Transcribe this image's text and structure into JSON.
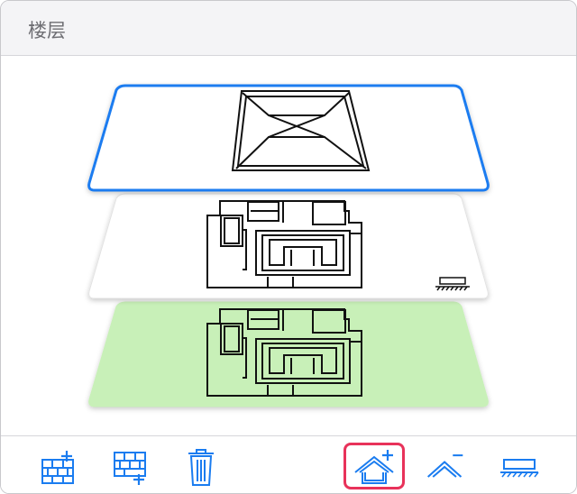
{
  "panel": {
    "title": "楼层"
  },
  "floors": [
    {
      "name": "roof",
      "selected": true,
      "fill": "#ffffff",
      "border": "#1a7cf0"
    },
    {
      "name": "upper-floor",
      "selected": false,
      "fill": "#ffffff",
      "border": "#dcdcdc"
    },
    {
      "name": "ground-floor",
      "selected": false,
      "fill": "#c8f0b8",
      "border": "#c8f0b8"
    }
  ],
  "toolbar": {
    "items": [
      {
        "icon": "add-wall-above-icon",
        "active": false
      },
      {
        "icon": "add-wall-below-icon",
        "active": false
      },
      {
        "icon": "trash-icon",
        "active": false
      },
      {
        "icon": "add-roof-icon",
        "active": true
      },
      {
        "icon": "remove-roof-icon",
        "active": false
      },
      {
        "icon": "foundation-icon",
        "active": false
      }
    ]
  },
  "colors": {
    "accent": "#1a7cf0",
    "active_outline": "#e8325a",
    "ground_floor_fill": "#c8f0b8"
  }
}
